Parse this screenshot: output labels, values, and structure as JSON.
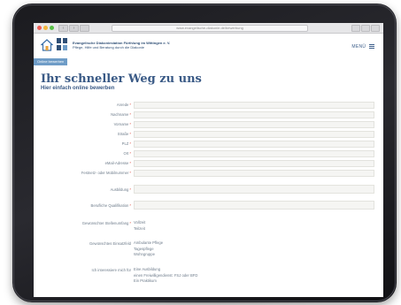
{
  "browser": {
    "address": "www.evangelische-diakonie.de/bewerbung"
  },
  "header": {
    "org_line1": "Evangelische Diakoniestation Fürth/ung im Wittingen e. V.",
    "org_line2": "Pflege, Hilfe und Beratung durch die Diakonie",
    "menu_label": "MENÜ"
  },
  "page": {
    "tag": "Online bewerben",
    "title": "Ihr schneller Weg zu uns",
    "subtitle": "Hier einfach online bewerben"
  },
  "form": {
    "required_mark": "*",
    "fields": [
      {
        "label": "Anrede",
        "required": true,
        "value": ""
      },
      {
        "label": "Nachname",
        "required": true,
        "value": ""
      },
      {
        "label": "Vorname",
        "required": true,
        "value": ""
      },
      {
        "label": "Straße",
        "required": true,
        "value": ""
      },
      {
        "label": "PLZ",
        "required": true,
        "value": ""
      },
      {
        "label": "Ort",
        "required": true,
        "value": ""
      },
      {
        "label": "eMail-Adresse",
        "required": true,
        "value": ""
      },
      {
        "label": "Festnetz- oder Mobilnummer",
        "required": true,
        "value": ""
      },
      {
        "label": "Ausbildung",
        "required": true,
        "value": ""
      },
      {
        "label": "Berufliche Qualifikation",
        "required": true,
        "value": ""
      }
    ],
    "stellenumfang": {
      "label": "Gewünschter Stellenumfang",
      "required": true,
      "options": [
        "Vollzeit",
        "Teilzeit"
      ]
    },
    "einsatzfeld": {
      "label": "Gewünschtes Einsatzfeld",
      "required": false,
      "options": [
        "Ambulante Pflege",
        "Tagespflege",
        "Wohngruppe"
      ]
    },
    "interesse": {
      "label": "Ich interessiere mich für",
      "required": false,
      "options": [
        "Eine Ausbildung",
        "einen Freiwilligendienst: FSJ oder BFD",
        "Ein Praktikum"
      ]
    }
  },
  "colors": {
    "brand_blue": "#3a5a86",
    "tag_blue": "#6e9cc7",
    "required_red": "#e04a3a",
    "device": "#1b1b1f"
  }
}
